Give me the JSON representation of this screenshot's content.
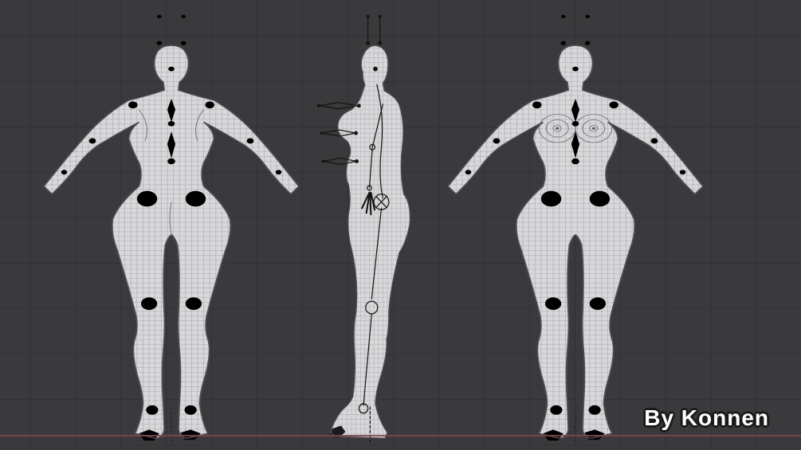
{
  "viewport": {
    "background_color": "#3a3a3c",
    "grid_color": "#323234",
    "axis_x_color": "#82454d",
    "model": {
      "body_color": "#d8d8da",
      "wire_color": "#8a8a90",
      "outline_color": "#4f4f54",
      "armature_color": "#141414"
    },
    "views": [
      "back",
      "side",
      "front"
    ]
  },
  "watermark": {
    "text": "By Konnen",
    "color": "#ffffff",
    "outline_color": "#1b1b1b"
  }
}
